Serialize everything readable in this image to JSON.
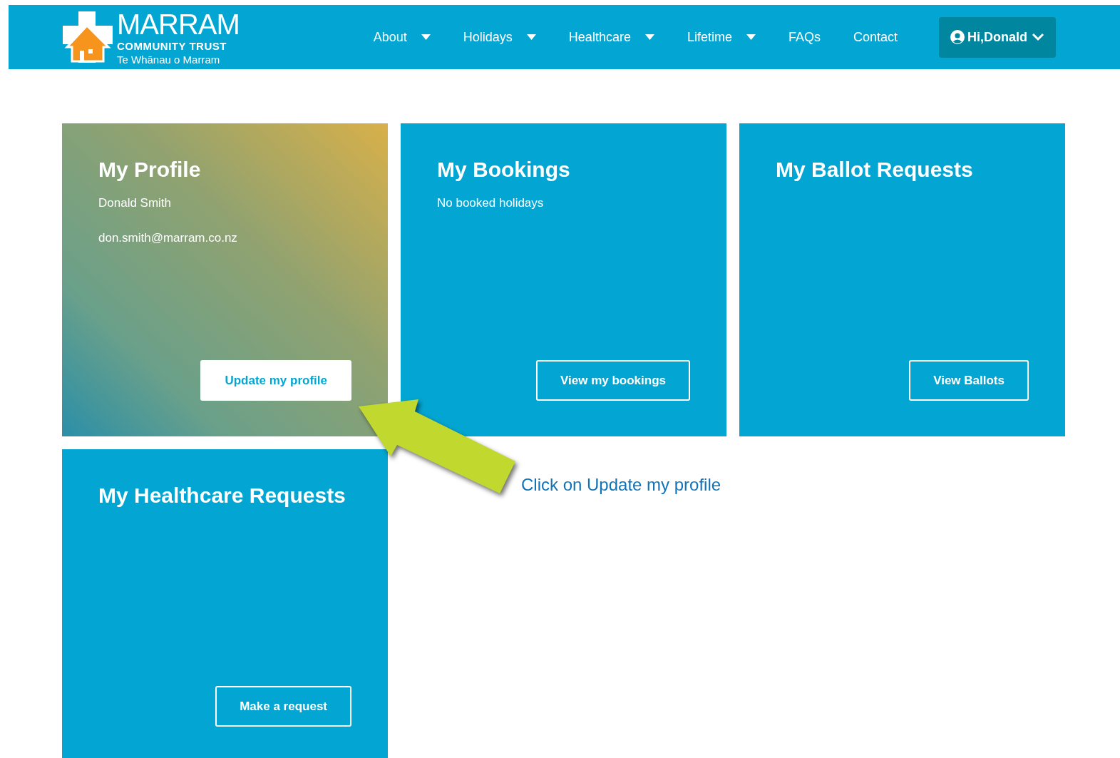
{
  "header": {
    "logo": {
      "name": "MARRAM",
      "subtitle": "COMMUNITY TRUST",
      "tagline": "Te Whānau o Marram"
    },
    "nav": [
      {
        "label": "About",
        "has_dropdown": true
      },
      {
        "label": "Holidays",
        "has_dropdown": true
      },
      {
        "label": "Healthcare",
        "has_dropdown": true
      },
      {
        "label": "Lifetime",
        "has_dropdown": true
      },
      {
        "label": "FAQs",
        "has_dropdown": false
      },
      {
        "label": "Contact",
        "has_dropdown": false
      }
    ],
    "user_menu": {
      "label": "Hi,Donald"
    }
  },
  "cards": [
    {
      "kind": "gradient",
      "title": "My Profile",
      "lines": [
        "Donald Smith",
        "don.smith@marram.co.nz"
      ],
      "button": {
        "label": "Update my profile",
        "kind": "filled"
      }
    },
    {
      "kind": "plain",
      "title": "My Bookings",
      "lines": [
        "No booked holidays"
      ],
      "button": {
        "label": "View my bookings",
        "kind": "outline"
      }
    },
    {
      "kind": "plain",
      "title": "My Ballot Requests",
      "button": {
        "label": "View Ballots",
        "kind": "outline"
      }
    },
    {
      "kind": "plain",
      "title": "My Healthcare Requests",
      "button": {
        "label": "Make a request",
        "kind": "outline"
      }
    }
  ],
  "annotation": {
    "text": "Click on Update my profile"
  }
}
